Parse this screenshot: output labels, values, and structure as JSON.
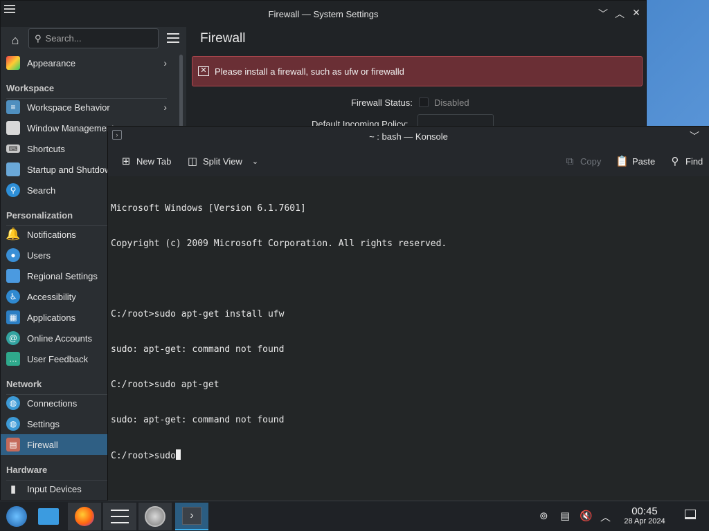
{
  "settings_window": {
    "title": "Firewall — System Settings",
    "search_placeholder": "Search...",
    "page_title": "Firewall",
    "alert_text": "Please install a firewall, such as ufw or firewalld",
    "firewall_status_label": "Firewall Status:",
    "firewall_status_value": "Disabled",
    "default_incoming_label": "Default Incoming Policy:",
    "sidebar": {
      "appearance": "Appearance",
      "workspace_head": "Workspace",
      "workspace_behavior": "Workspace Behavior",
      "window_management": "Window Management",
      "shortcuts": "Shortcuts",
      "startup": "Startup and Shutdown",
      "search": "Search",
      "personalization_head": "Personalization",
      "notifications": "Notifications",
      "users": "Users",
      "regional": "Regional Settings",
      "accessibility": "Accessibility",
      "applications": "Applications",
      "online_accounts": "Online Accounts",
      "user_feedback": "User Feedback",
      "network_head": "Network",
      "connections": "Connections",
      "settings": "Settings",
      "firewall": "Firewall",
      "hardware_head": "Hardware",
      "input_devices": "Input Devices"
    }
  },
  "konsole": {
    "title": "~ : bash — Konsole",
    "toolbar": {
      "new_tab": "New Tab",
      "split_view": "Split View",
      "copy": "Copy",
      "paste": "Paste",
      "find": "Find"
    },
    "lines": [
      "Microsoft Windows [Version 6.1.7601]",
      "Copyright (c) 2009 Microsoft Corporation. All rights reserved.",
      "",
      "C:/root>sudo apt-get install ufw",
      "sudo: apt-get: command not found",
      "C:/root>sudo apt-get",
      "sudo: apt-get: command not found"
    ],
    "prompt_line": "C:/root>sudo"
  },
  "taskbar": {
    "time": "00:45",
    "date": "28 Apr 2024",
    "apps": [
      "start-menu",
      "file-manager",
      "firefox",
      "system-settings",
      "safari",
      "konsole"
    ]
  },
  "colors": {
    "accent": "#3daee9",
    "selection": "#2f5f84",
    "alert_bg": "#6a2f35",
    "alert_border": "#b24950"
  }
}
